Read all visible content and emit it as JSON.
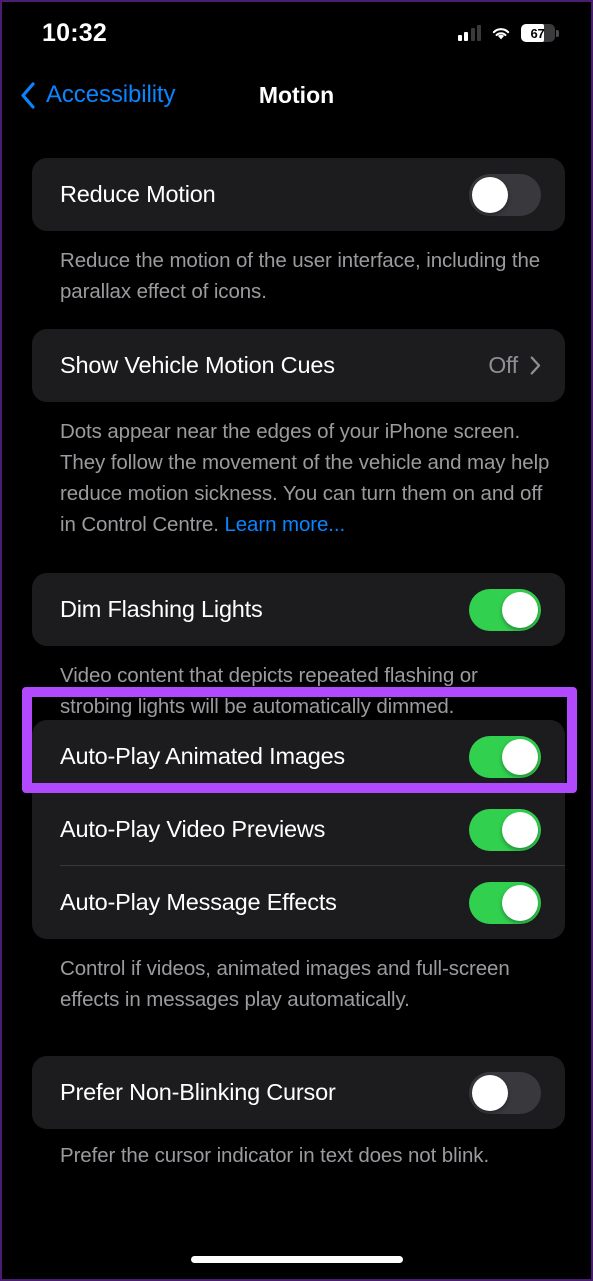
{
  "status_bar": {
    "time": "10:32",
    "battery_percent": "67",
    "battery_level": 67,
    "signal_icon": "cellular-bars-icon",
    "wifi_icon": "wifi-icon",
    "battery_icon": "battery-icon"
  },
  "nav": {
    "back_label": "Accessibility",
    "back_icon": "chevron-left-icon",
    "title": "Motion"
  },
  "colors": {
    "accent_blue": "#0a84ff",
    "toggle_on_green": "#32d04f",
    "toggle_off_gray": "#39393d",
    "card_background": "#1c1c1e",
    "highlight_purple": "#b14aff",
    "page_background": "#000000",
    "footnote_gray": "#9b9b9f"
  },
  "sections": [
    {
      "id": "reduce-motion",
      "rows": [
        {
          "label": "Reduce Motion",
          "control": "toggle",
          "value": "off"
        }
      ],
      "footnote": "Reduce the motion of the user interface, including the parallax effect of icons."
    },
    {
      "id": "vehicle-motion-cues",
      "rows": [
        {
          "label": "Show Vehicle Motion Cues",
          "control": "disclosure",
          "value": "Off",
          "chevron_icon": "chevron-right-icon"
        }
      ],
      "footnote": "Dots appear near the edges of your iPhone screen. They follow the movement of the vehicle and may help reduce motion sickness. You can turn them on and off in Control Centre. ",
      "footnote_link": "Learn more..."
    },
    {
      "id": "dim-flashing-lights",
      "highlighted": true,
      "rows": [
        {
          "label": "Dim Flashing Lights",
          "control": "toggle",
          "value": "on"
        }
      ],
      "footnote": "Video content that depicts repeated flashing or strobing lights will be automatically dimmed."
    },
    {
      "id": "auto-play",
      "rows": [
        {
          "label": "Auto-Play Animated Images",
          "control": "toggle",
          "value": "on"
        },
        {
          "label": "Auto-Play Video Previews",
          "control": "toggle",
          "value": "on"
        },
        {
          "label": "Auto-Play Message Effects",
          "control": "toggle",
          "value": "on"
        }
      ],
      "footnote": "Control if videos, animated images and full-screen effects in messages play automatically."
    },
    {
      "id": "non-blinking-cursor",
      "rows": [
        {
          "label": "Prefer Non-Blinking Cursor",
          "control": "toggle",
          "value": "off"
        }
      ],
      "footnote": "Prefer the cursor indicator in text does not blink."
    }
  ]
}
